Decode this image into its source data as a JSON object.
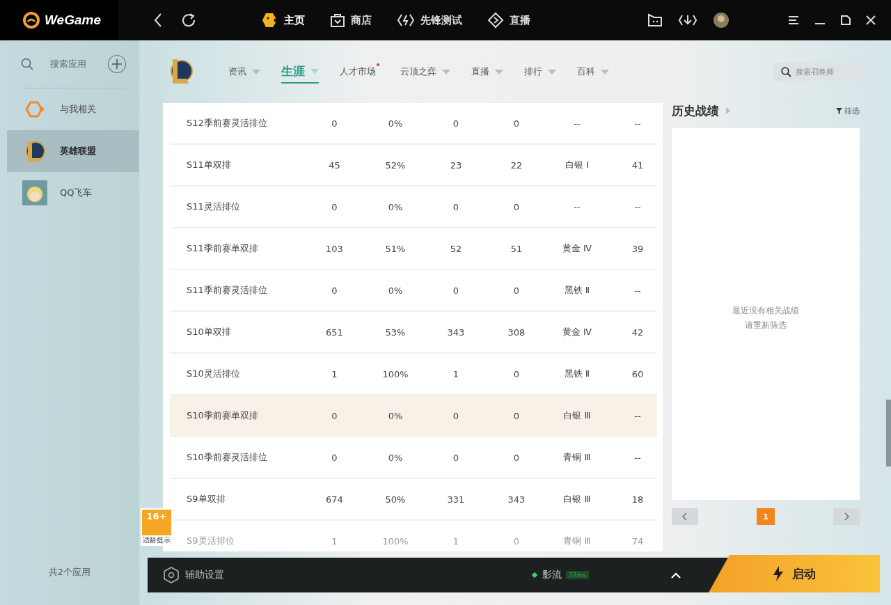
{
  "topbar": {
    "logo": "WeGame",
    "nav": [
      {
        "label": "主页",
        "selected": true
      },
      {
        "label": "商店",
        "selected": false
      },
      {
        "label": "先锋测试",
        "selected": false
      },
      {
        "label": "直播",
        "selected": false
      }
    ]
  },
  "sidebar": {
    "search_placeholder": "搜索应用",
    "items": [
      {
        "label": "与我相关",
        "selected": false
      },
      {
        "label": "英雄联盟",
        "selected": true
      },
      {
        "label": "QQ飞车",
        "selected": false
      }
    ],
    "footer": "共2个应用"
  },
  "subnav": {
    "tabs": [
      {
        "label": "资讯",
        "selected": false,
        "dot": false,
        "caret": true
      },
      {
        "label": "生涯",
        "selected": true,
        "dot": false,
        "caret": true
      },
      {
        "label": "人才市场",
        "selected": false,
        "dot": true,
        "caret": false
      },
      {
        "label": "云顶之弈",
        "selected": false,
        "dot": false,
        "caret": true
      },
      {
        "label": "直播",
        "selected": false,
        "dot": false,
        "caret": true
      },
      {
        "label": "排行",
        "selected": false,
        "dot": false,
        "caret": true
      },
      {
        "label": "百科",
        "selected": false,
        "dot": false,
        "caret": true
      }
    ],
    "search_placeholder": "搜索召唤师"
  },
  "table": {
    "rows": [
      {
        "cells": [
          "S12季前赛灵活排位",
          "0",
          "0%",
          "0",
          "0",
          "--",
          "--"
        ],
        "selected": false
      },
      {
        "cells": [
          "S11单双排",
          "45",
          "52%",
          "23",
          "22",
          "白银 Ⅰ",
          "41"
        ],
        "selected": false
      },
      {
        "cells": [
          "S11灵活排位",
          "0",
          "0%",
          "0",
          "0",
          "--",
          "--"
        ],
        "selected": false
      },
      {
        "cells": [
          "S11季前赛单双排",
          "103",
          "51%",
          "52",
          "51",
          "黄金 Ⅳ",
          "39"
        ],
        "selected": false
      },
      {
        "cells": [
          "S11季前赛灵活排位",
          "0",
          "0%",
          "0",
          "0",
          "黑铁 Ⅱ",
          "--"
        ],
        "selected": false
      },
      {
        "cells": [
          "S10单双排",
          "651",
          "53%",
          "343",
          "308",
          "黄金 Ⅳ",
          "42"
        ],
        "selected": false
      },
      {
        "cells": [
          "S10灵活排位",
          "1",
          "100%",
          "1",
          "0",
          "黑铁 Ⅱ",
          "60"
        ],
        "selected": false
      },
      {
        "cells": [
          "S10季前赛单双排",
          "0",
          "0%",
          "0",
          "0",
          "白银 Ⅲ",
          "--"
        ],
        "selected": true
      },
      {
        "cells": [
          "S10季前赛灵活排位",
          "0",
          "0%",
          "0",
          "0",
          "青铜 Ⅲ",
          "--"
        ],
        "selected": false
      },
      {
        "cells": [
          "S9单双排",
          "674",
          "50%",
          "331",
          "343",
          "白银 Ⅲ",
          "18"
        ],
        "selected": false
      },
      {
        "cells": [
          "S9灵活排位",
          "1",
          "100%",
          "1",
          "0",
          "青铜 Ⅲ",
          "74"
        ],
        "selected": false
      }
    ]
  },
  "history": {
    "title": "历史战绩",
    "filter": "筛选",
    "empty_lines": [
      "最近没有相关战绩",
      "请重新筛选"
    ],
    "pages": [
      {
        "label": "1",
        "selected": true
      }
    ]
  },
  "age_badge": {
    "rating": "16+",
    "note": "适龄提示"
  },
  "bottombar": {
    "settings": "辅助设置",
    "server": "影流",
    "ping": "37ms",
    "launch": "启动"
  }
}
